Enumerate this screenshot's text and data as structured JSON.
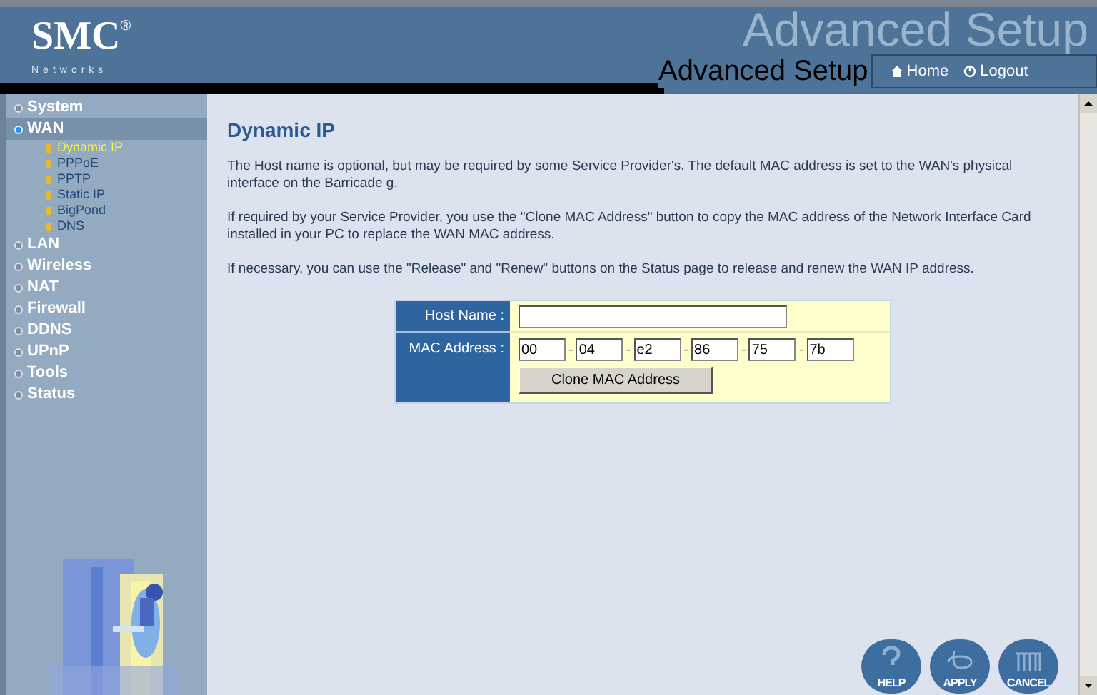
{
  "header": {
    "logo": "SMC",
    "logo_mark": "®",
    "logo_sub": "Networks",
    "banner_title": "Advanced Setup",
    "title": "Advanced Setup",
    "links": [
      {
        "label": "Home",
        "kind": "home"
      },
      {
        "label": "Logout",
        "kind": "logout"
      }
    ]
  },
  "sidebar": {
    "items": [
      {
        "label": "System",
        "selected": false,
        "expanded": false
      },
      {
        "label": "WAN",
        "selected": true,
        "expanded": true,
        "children": [
          {
            "label": "Dynamic IP",
            "selected": true
          },
          {
            "label": "PPPoE",
            "selected": false
          },
          {
            "label": "PPTP",
            "selected": false
          },
          {
            "label": "Static IP",
            "selected": false
          },
          {
            "label": "BigPond",
            "selected": false
          },
          {
            "label": "DNS",
            "selected": false
          }
        ]
      },
      {
        "label": "LAN",
        "selected": false,
        "expanded": false
      },
      {
        "label": "Wireless",
        "selected": false,
        "expanded": false
      },
      {
        "label": "NAT",
        "selected": false,
        "expanded": false
      },
      {
        "label": "Firewall",
        "selected": false,
        "expanded": false
      },
      {
        "label": "DDNS",
        "selected": false,
        "expanded": false
      },
      {
        "label": "UPnP",
        "selected": false,
        "expanded": false
      },
      {
        "label": "Tools",
        "selected": false,
        "expanded": false
      },
      {
        "label": "Status",
        "selected": false,
        "expanded": false
      }
    ]
  },
  "main": {
    "heading": "Dynamic IP",
    "paragraphs": [
      "The Host name is optional, but may be required by some Service Provider's. The default MAC address is set to the WAN's physical interface on the Barricade g.",
      "If required by your Service Provider, you use the \"Clone MAC Address\" button to copy the MAC address of the Network Interface Card installed in your PC to replace the WAN MAC address.",
      "If necessary, you can use the \"Release\" and \"Renew\" buttons on the Status page to release and renew the WAN IP address."
    ],
    "form": {
      "host_name": {
        "label": "Host Name :"
      },
      "mac_address": {
        "label": "MAC Address :",
        "separator": "-",
        "octets": [
          "00",
          "04",
          "e2",
          "86",
          "75",
          "7b"
        ]
      },
      "clone_button": "Clone MAC Address"
    },
    "actions": [
      {
        "label": "HELP",
        "kind": "help"
      },
      {
        "label": "APPLY",
        "kind": "apply"
      },
      {
        "label": "CANCEL",
        "kind": "cancel"
      }
    ]
  }
}
